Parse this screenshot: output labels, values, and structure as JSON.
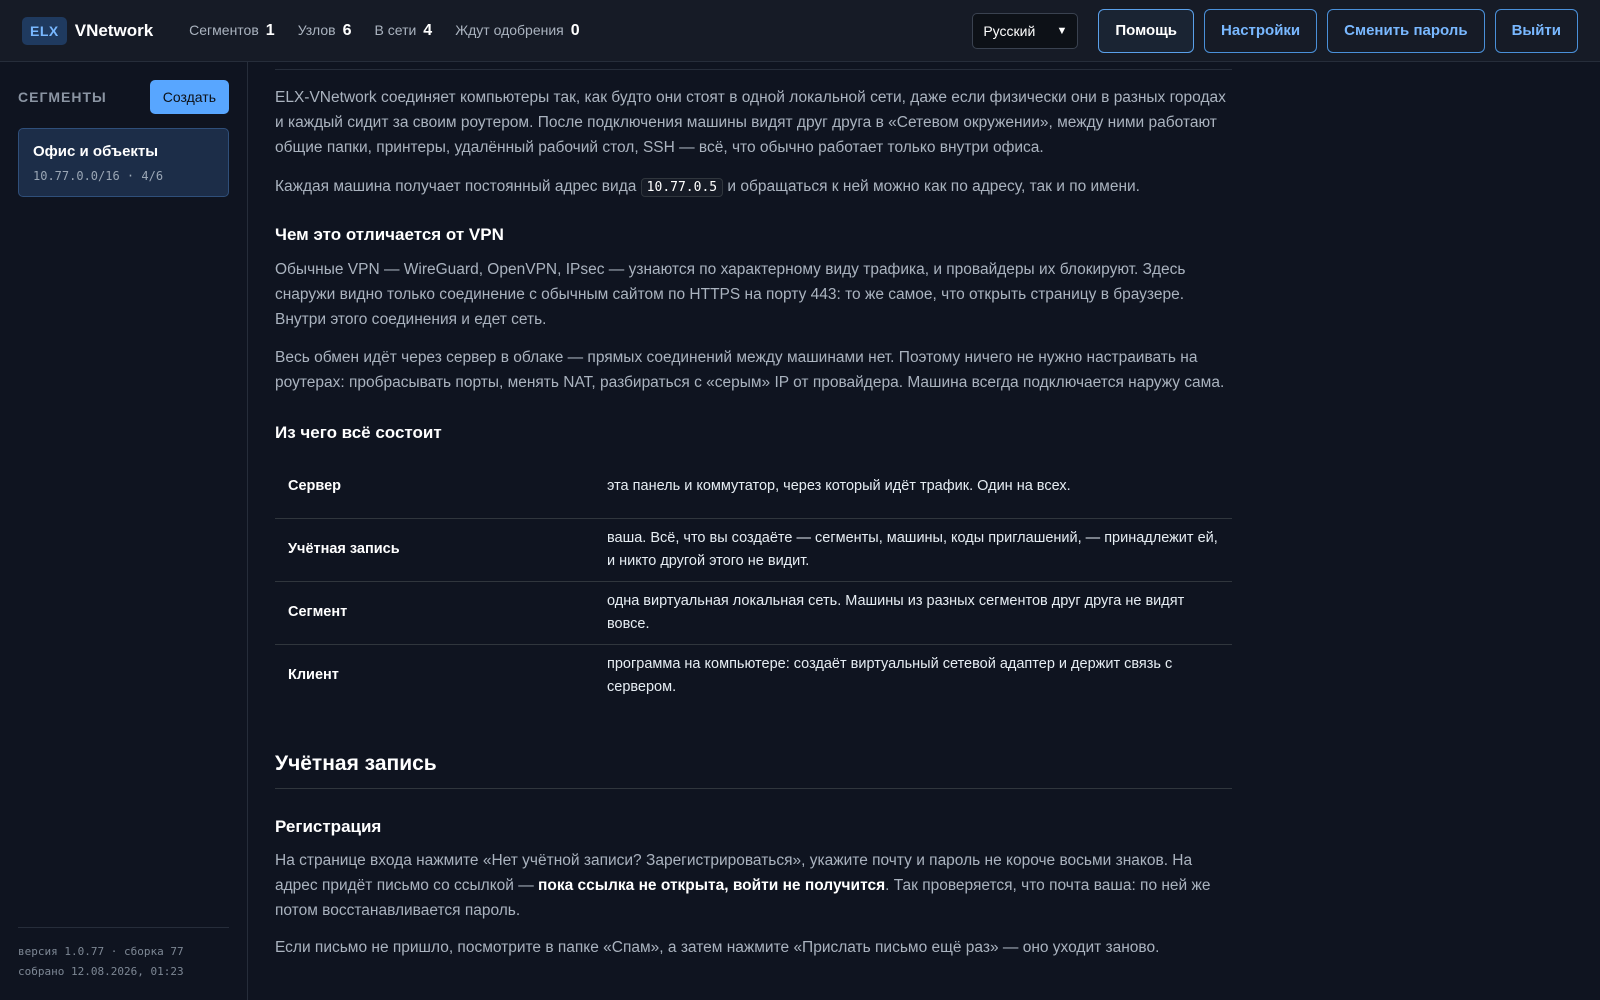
{
  "topbar": {
    "brand_badge": "ELX",
    "brand_name": "VNetwork",
    "stats": [
      {
        "label": "Сегментов",
        "value": "1"
      },
      {
        "label": "Узлов",
        "value": "6"
      },
      {
        "label": "В сети",
        "value": "4"
      },
      {
        "label": "Ждут одобрения",
        "value": "0"
      }
    ],
    "language": "Русский",
    "buttons": {
      "help": "Помощь",
      "settings": "Настройки",
      "change_password": "Сменить пароль",
      "logout": "Выйти"
    }
  },
  "sidebar": {
    "title": "СЕГМЕНТЫ",
    "create_label": "Создать",
    "segments": [
      {
        "name": "Офис и объекты",
        "meta": "10.77.0.0/16 · 4/6"
      }
    ],
    "footer": {
      "version": "версия 1.0.77 · сборка 77",
      "built": "собрано 12.08.2026, 01:23"
    }
  },
  "content": {
    "intro": "ELX-VNetwork соединяет компьютеры так, как будто они стоят в одной локальной сети, даже если физически они в разных городах и каждый сидит за своим роутером. После подключения машины видят друг друга в «Сетевом окружении», между ними работают общие папки, принтеры, удалённый рабочий стол, SSH — всё, что обычно работает только внутри офиса.",
    "address_before": "Каждая машина получает постоянный адрес вида ",
    "address_code": "10.77.0.5",
    "address_after": " и обращаться к ней можно как по адресу, так и по имени.",
    "vpn_heading": "Чем это отличается от VPN",
    "vpn_p1": "Обычные VPN — WireGuard, OpenVPN, IPsec — узнаются по характерному виду трафика, и провайдеры их блокируют. Здесь снаружи видно только соединение с обычным сайтом по HTTPS на порту 443: то же самое, что открыть страницу в браузере. Внутри этого соединения и едет сеть.",
    "vpn_p2": "Весь обмен идёт через сервер в облаке — прямых соединений между машинами нет. Поэтому ничего не нужно настраивать на роутерах: пробрасывать порты, менять NAT, разбираться с «серым» IP от провайдера. Машина всегда подключается наружу сама.",
    "parts_heading": "Из чего всё состоит",
    "parts": [
      {
        "term": "Сервер",
        "def": "эта панель и коммутатор, через который идёт трафик. Один на всех."
      },
      {
        "term": "Учётная запись",
        "def": "ваша. Всё, что вы создаёте — сегменты, машины, коды приглашений, — принадлежит ей, и никто другой этого не видит."
      },
      {
        "term": "Сегмент",
        "def": "одна виртуальная локальная сеть. Машины из разных сегментов друг друга не видят вовсе."
      },
      {
        "term": "Клиент",
        "def": "программа на компьютере: создаёт виртуальный сетевой адаптер и держит связь с сервером."
      }
    ],
    "account_heading": "Учётная запись",
    "reg_heading": "Регистрация",
    "reg_p1_before": "На странице входа нажмите «Нет учётной записи? Зарегистрироваться», укажите почту и пароль не короче восьми знаков. На адрес придёт письмо со ссылкой — ",
    "reg_p1_bold": "пока ссылка не открыта, войти не получится",
    "reg_p1_after": ". Так проверяется, что почта ваша: по ней же потом восстанавливается пароль.",
    "reg_p2": "Если письмо не пришло, посмотрите в папке «Спам», а затем нажмите «Прислать письмо ещё раз» — оно уходит заново."
  }
}
